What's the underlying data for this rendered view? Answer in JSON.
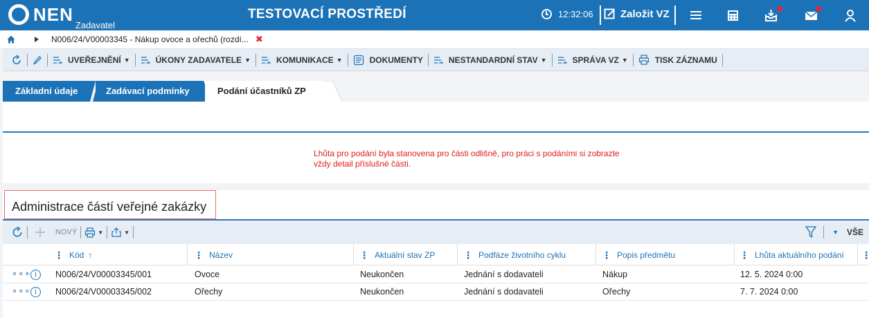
{
  "header": {
    "logo_text": "NEN",
    "logo_sub": "Zadavatel",
    "env_title": "TESTOVACÍ PROSTŘEDÍ",
    "time": "12:32:06",
    "create_label": "Založit VZ",
    "icons": [
      "menu-icon",
      "calculator-icon",
      "inbox-icon",
      "mail-icon",
      "user-icon"
    ],
    "accent": "#1c72b6",
    "badge_color": "#e0263b"
  },
  "breadcrumb": {
    "text": "N006/24/V00003345 - Nákup ovoce a ořechů (rozdí...",
    "close": "✖"
  },
  "toolbar": {
    "items": [
      {
        "label": "UVEŘEJNĚNÍ"
      },
      {
        "label": "ÚKONY ZADAVATELE"
      },
      {
        "label": "KOMUNIKACE"
      },
      {
        "label": "DOKUMENTY"
      },
      {
        "label": "NESTANDARDNÍ STAV"
      },
      {
        "label": "SPRÁVA VZ"
      },
      {
        "label": "TISK ZÁZNAMU"
      }
    ]
  },
  "tabs": [
    {
      "label": "Základní údaje"
    },
    {
      "label": "Zadávací podmínky"
    },
    {
      "label": "Podání účastníků ZP"
    }
  ],
  "notice": "Lhůta pro podání byla stanovena pro části odlišně, pro práci s podáními si zobrazte vždy detail příslušné části.",
  "section": {
    "title": "Administrace částí veřejné zakázky",
    "new_label": "NOVÝ",
    "filter_label": "VŠE"
  },
  "table": {
    "columns": [
      "Kód",
      "Název",
      "Aktuální stav ZP",
      "Podfáze životního cyklu",
      "Popis předmětu",
      "Lhůta aktuálního podání"
    ],
    "sort_indicator": "↑",
    "rows": [
      [
        "N006/24/V00003345/001",
        "Ovoce",
        "Neukončen",
        "Jednání s dodavateli",
        "Nákup",
        "12. 5. 2024 0:00"
      ],
      [
        "N006/24/V00003345/002",
        "Ořechy",
        "Neukončen",
        "Jednání s dodavateli",
        "Ořechy",
        "7. 7. 2024 0:00"
      ]
    ]
  }
}
